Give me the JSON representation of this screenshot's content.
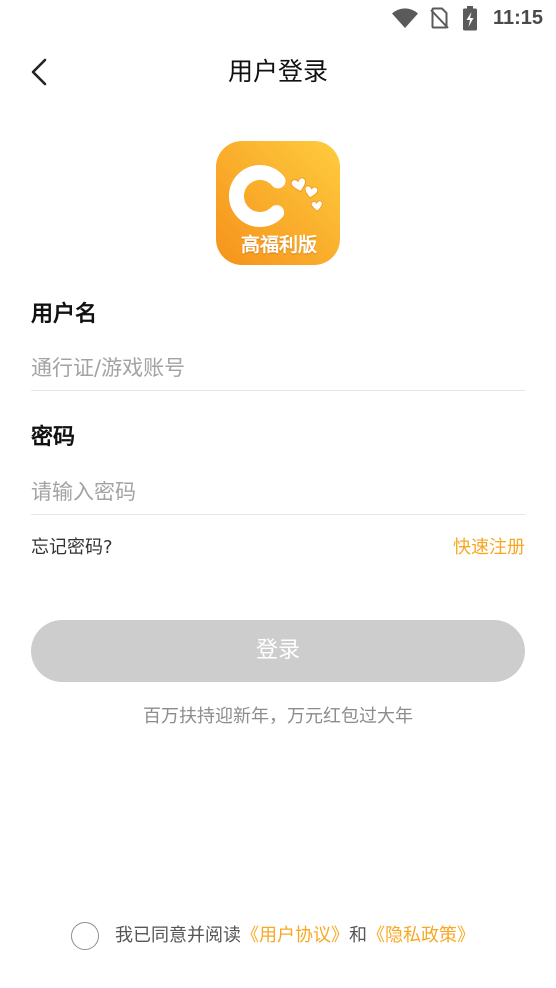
{
  "status_bar": {
    "time": "11:15",
    "icons": {
      "wifi": "wifi-icon",
      "sim": "no-sim-icon",
      "battery": "battery-charging-icon"
    }
  },
  "header": {
    "back_icon": "chevron-left-icon",
    "title": "用户登录"
  },
  "logo": {
    "badge_text": "高福利版",
    "gradient_start": "#FFCC3E",
    "gradient_end": "#F5921B"
  },
  "form": {
    "username": {
      "label": "用户名",
      "placeholder": "通行证/游戏账号",
      "value": ""
    },
    "password": {
      "label": "密码",
      "placeholder": "请输入密码",
      "value": ""
    },
    "forgot_password": "忘记密码?",
    "register": "快速注册",
    "login_button": {
      "label": "登录",
      "enabled": false
    }
  },
  "promo_text": "百万扶持迎新年，万元红包过大年",
  "agreement": {
    "checked": false,
    "prefix": "我已同意并阅读",
    "user_agreement": "《用户协议》",
    "conjunction": "和",
    "privacy_policy": "《隐私政策》"
  },
  "colors": {
    "accent": "#F7A823",
    "button_disabled": "#CDCDCD",
    "text_primary": "#111111",
    "placeholder": "#A3A3A3"
  }
}
